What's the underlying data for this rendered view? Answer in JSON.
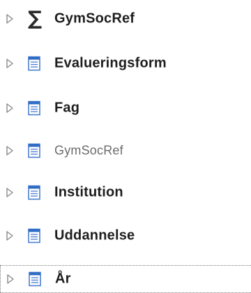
{
  "fields_tree": {
    "items": [
      {
        "label": "GymSocRef",
        "icon": "sigma-icon",
        "kind": "measure-table"
      },
      {
        "label": "Evalueringsform",
        "icon": "table-icon",
        "kind": "table"
      },
      {
        "label": "Fag",
        "icon": "table-icon",
        "kind": "table"
      },
      {
        "label": "GymSocRef",
        "icon": "table-icon",
        "kind": "table-hidden"
      },
      {
        "label": "Institution",
        "icon": "table-icon",
        "kind": "table"
      },
      {
        "label": "Uddannelse",
        "icon": "table-icon",
        "kind": "table"
      },
      {
        "label": "År",
        "icon": "table-icon",
        "kind": "table",
        "focused": true
      }
    ]
  },
  "colors": {
    "icon_blue": "#2e6bc4",
    "icon_border": "#4a7fd0",
    "text_primary": "#1e1e1e",
    "text_hidden": "#6d6d6d",
    "expander": "#8a8a8a"
  }
}
